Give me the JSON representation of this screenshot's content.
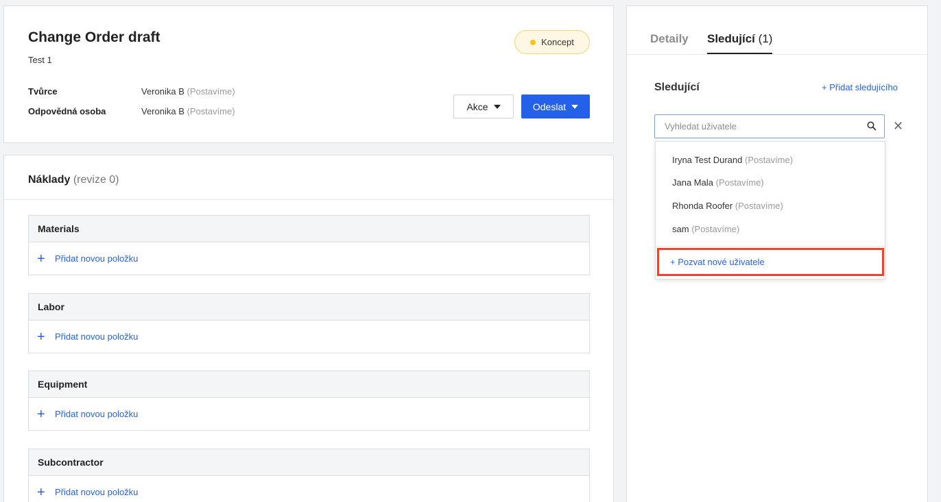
{
  "header": {
    "title": "Change Order draft",
    "subtitle": "Test 1",
    "status_badge": "Koncept",
    "status_color": "#f5c518",
    "creator_label": "Tvůrce",
    "creator_name": "Veronika B",
    "creator_company": "(Postavíme)",
    "responsible_label": "Odpovědná osoba",
    "responsible_name": "Veronika B",
    "responsible_company": "(Postavíme)",
    "actions_button": "Akce",
    "send_button": "Odeslat",
    "accent_color": "#2461e8"
  },
  "costs": {
    "title": "Náklady",
    "revision": "(revize 0)",
    "add_item_label": "Přidat novou položku",
    "sections": [
      {
        "name": "Materials"
      },
      {
        "name": "Labor"
      },
      {
        "name": "Equipment"
      },
      {
        "name": "Subcontractor"
      }
    ]
  },
  "side_panel": {
    "tabs": {
      "detail": "Detaily",
      "followers": "Sledující",
      "followers_count": "(1)"
    },
    "followers_title": "Sledující",
    "add_follower": "+ Přidat sledujícího",
    "search": {
      "placeholder": "Vyhledat uživatele",
      "value": ""
    },
    "icons": {
      "search": "search-icon",
      "close": "close-icon"
    },
    "dropdown": {
      "users": [
        {
          "name": "Iryna Test Durand",
          "company": "(Postavíme)"
        },
        {
          "name": "Jana Mala",
          "company": "(Postavíme)"
        },
        {
          "name": "Rhonda Roofer",
          "company": "(Postavíme)"
        },
        {
          "name": "sam",
          "company": "(Postavíme)"
        }
      ],
      "invite_label": "+ Pozvat nové uživatele",
      "highlight_color": "#e8472f"
    }
  }
}
